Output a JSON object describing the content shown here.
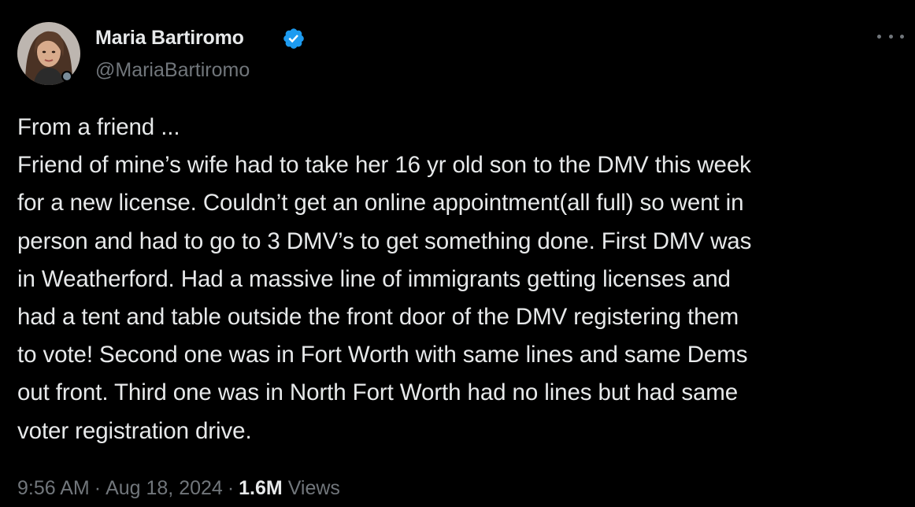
{
  "author": {
    "display_name": "Maria Bartiromo",
    "handle": "@MariaBartiromo",
    "verified": true,
    "verified_color": "#1d9bf0"
  },
  "tweet": {
    "lines": [
      "From a friend ...",
      "Friend of mine’s wife had to take her 16 yr old son to the DMV this week",
      "for a new license. Couldn’t get an online appointment(all full) so went in",
      "person and had to go to 3 DMV’s to get something done. First DMV was",
      "in Weatherford. Had a massive line of immigrants getting licenses and",
      "had a tent and table outside the front door of the DMV registering them",
      "to vote! Second one was in Fort Worth with same lines and same Dems",
      "out front. Third one was in North Fort Worth had no lines but had same",
      "voter registration drive."
    ]
  },
  "meta": {
    "time": "9:56 AM",
    "date": "Aug 18, 2024",
    "separator": "·",
    "views_count": "1.6M",
    "views_label": "Views"
  },
  "icons": {
    "more": "more-options-icon",
    "verified": "verified-badge-icon"
  },
  "colors": {
    "background": "#000000",
    "text_primary": "#e7e9ea",
    "text_secondary": "#71767b"
  }
}
